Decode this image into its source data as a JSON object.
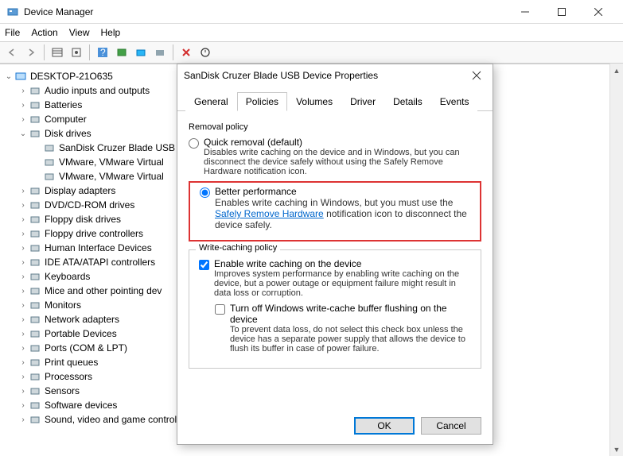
{
  "window": {
    "title": "Device Manager"
  },
  "menu": {
    "file": "File",
    "action": "Action",
    "view": "View",
    "help": "Help"
  },
  "tree": {
    "root": "DESKTOP-21O635",
    "items": [
      {
        "label": "Audio inputs and outputs",
        "indent": 1,
        "tw": "›"
      },
      {
        "label": "Batteries",
        "indent": 1,
        "tw": "›"
      },
      {
        "label": "Computer",
        "indent": 1,
        "tw": "›"
      },
      {
        "label": "Disk drives",
        "indent": 1,
        "tw": "⌄"
      },
      {
        "label": "SanDisk Cruzer Blade USB",
        "indent": 2,
        "tw": ""
      },
      {
        "label": "VMware, VMware Virtual",
        "indent": 2,
        "tw": ""
      },
      {
        "label": "VMware, VMware Virtual",
        "indent": 2,
        "tw": ""
      },
      {
        "label": "Display adapters",
        "indent": 1,
        "tw": "›"
      },
      {
        "label": "DVD/CD-ROM drives",
        "indent": 1,
        "tw": "›"
      },
      {
        "label": "Floppy disk drives",
        "indent": 1,
        "tw": "›"
      },
      {
        "label": "Floppy drive controllers",
        "indent": 1,
        "tw": "›"
      },
      {
        "label": "Human Interface Devices",
        "indent": 1,
        "tw": "›"
      },
      {
        "label": "IDE ATA/ATAPI controllers",
        "indent": 1,
        "tw": "›"
      },
      {
        "label": "Keyboards",
        "indent": 1,
        "tw": "›"
      },
      {
        "label": "Mice and other pointing dev",
        "indent": 1,
        "tw": "›"
      },
      {
        "label": "Monitors",
        "indent": 1,
        "tw": "›"
      },
      {
        "label": "Network adapters",
        "indent": 1,
        "tw": "›"
      },
      {
        "label": "Portable Devices",
        "indent": 1,
        "tw": "›"
      },
      {
        "label": "Ports (COM & LPT)",
        "indent": 1,
        "tw": "›"
      },
      {
        "label": "Print queues",
        "indent": 1,
        "tw": "›"
      },
      {
        "label": "Processors",
        "indent": 1,
        "tw": "›"
      },
      {
        "label": "Sensors",
        "indent": 1,
        "tw": "›"
      },
      {
        "label": "Software devices",
        "indent": 1,
        "tw": "›"
      },
      {
        "label": "Sound, video and game controllers",
        "indent": 1,
        "tw": "›"
      }
    ]
  },
  "dialog": {
    "title": "SanDisk Cruzer Blade USB Device Properties",
    "tabs": [
      "General",
      "Policies",
      "Volumes",
      "Driver",
      "Details",
      "Events"
    ],
    "active_tab": "Policies",
    "removal": {
      "group": "Removal policy",
      "quick": {
        "title": "Quick removal (default)",
        "desc": "Disables write caching on the device and in Windows, but you can disconnect the device safely without using the Safely Remove Hardware notification icon."
      },
      "better": {
        "title": "Better performance",
        "desc_pre": "Enables write caching in Windows, but you must use the ",
        "link": "Safely Remove Hardware",
        "desc_post": " notification icon to disconnect the device safely."
      }
    },
    "writecache": {
      "group": "Write-caching policy",
      "enable": {
        "title": "Enable write caching on the device",
        "desc": "Improves system performance by enabling write caching on the device, but a power outage or equipment failure might result in data loss or corruption."
      },
      "turnoff": {
        "title": "Turn off Windows write-cache buffer flushing on the device",
        "desc": "To prevent data loss, do not select this check box unless the device has a separate power supply that allows the device to flush its buffer in case of power failure."
      }
    },
    "buttons": {
      "ok": "OK",
      "cancel": "Cancel"
    }
  }
}
